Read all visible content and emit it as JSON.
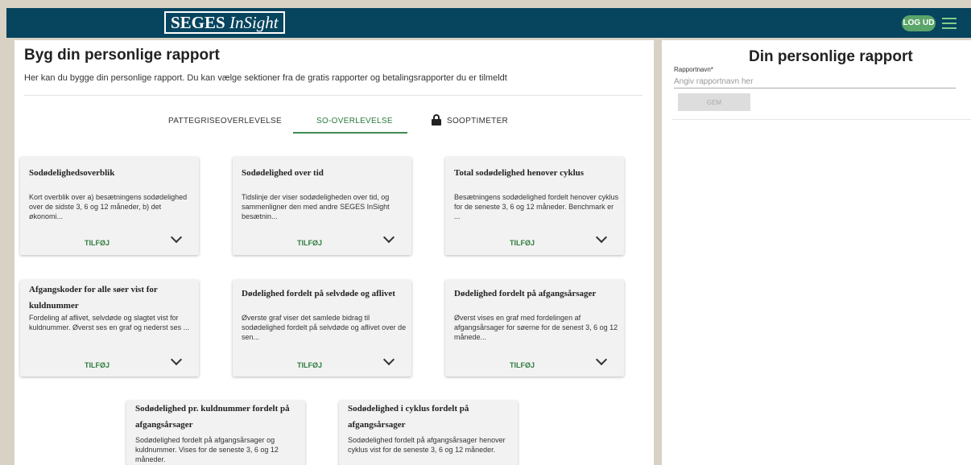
{
  "header": {
    "logo_bold": "SEGES",
    "logo_italic": "InSight",
    "logout_label": "LOG UD",
    "menu_icon": "hamburger-menu-icon",
    "brand_color": "#07445e",
    "accent_color": "#5aa56a"
  },
  "main": {
    "title": "Byg din personlige rapport",
    "description": "Her kan du bygge din personlige rapport. Du kan vælge sektioner fra de gratis rapporter og betalingsrapporter du er tilmeldt",
    "tabs": [
      {
        "label": "PATTEGRISEOVERLEVELSE",
        "active": false
      },
      {
        "label": "SO-OVERLEVELSE",
        "active": true
      },
      {
        "label": "SOOPTIMETER",
        "active": false,
        "locked": true,
        "icon": "lock-icon"
      }
    ],
    "cards": [
      {
        "title": "Sodødelighedsoverblik",
        "description": "Kort overblik over a) besætningens sodødelighed over de sidste 3, 6 og 12 måneder, b) det økonomi...",
        "add_label": "TILFØJ"
      },
      {
        "title": "Sodødelighed over tid",
        "description": "Tidslinje der viser sodødeligheden over tid, og sammenligner den med andre SEGES InSight besætnin...",
        "add_label": "TILFØJ"
      },
      {
        "title": "Total sodødelighed henover cyklus",
        "description": "Besætningens sodødelighed fordelt henover cyklus for de seneste 3, 6 og 12 måneder. Benchmark er ...",
        "add_label": "TILFØJ"
      },
      {
        "title": "Afgangskoder for alle søer vist for kuldnummer",
        "description": "Fordeling af aflivet, selvdøde og slagtet vist for kuldnummer. Øverst ses en graf og nederst ses ...",
        "add_label": "TILFØJ"
      },
      {
        "title": "Dødelighed fordelt på selvdøde og aflivet",
        "description": "Øverste graf viser det samlede bidrag til sodødelighed fordelt på selvdøde og aflivet over de sen...",
        "add_label": "TILFØJ"
      },
      {
        "title": "Dødelighed fordelt på afgangsårsager",
        "description": "Øverst vises en graf med fordelingen af afgangsårsager for søerne for de senest 3, 6 og 12 månede...",
        "add_label": "TILFØJ"
      },
      {
        "title": "Sodødelighed pr. kuldnummer fordelt på afgangsårsager",
        "description": "Sodødelighed fordelt på afgangsårsager og kuldnummer. Vises for de seneste 3, 6 og 12 måneder."
      },
      {
        "title": "Sodødelighed i cyklus fordelt på afgangsårsager",
        "description": "Sodødelighed fordelt på afgangsårsager henover cyklus vist for de seneste 3, 6 og 12 måneder."
      }
    ]
  },
  "sidebar": {
    "title": "Din personlige rapport",
    "field_label": "Rapportnavn*",
    "field_value": "",
    "field_placeholder": "Angiv rapportnavn her",
    "save_label": "GEM"
  }
}
